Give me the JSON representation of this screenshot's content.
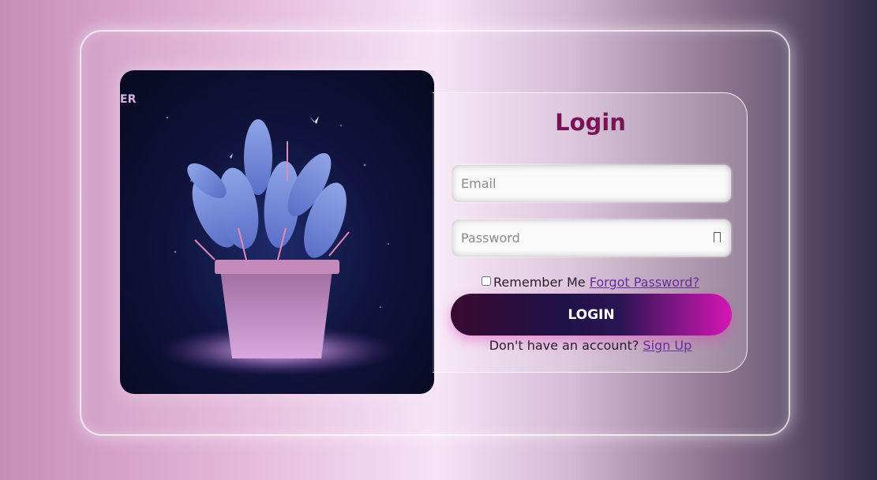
{
  "login_form": {
    "title": "Login",
    "email_placeholder": "Email",
    "password_placeholder": "Password",
    "remember_label": "Remember Me",
    "forgot_password_link": "Forgot Password?",
    "login_button": "LOGIN",
    "signup_prompt": "Don't have an account?",
    "signup_link": "Sign Up"
  },
  "illustration": {
    "corner_text": "ER",
    "subject": "potted-plant-illustration"
  },
  "colors": {
    "title": "#7a1257",
    "link": "#6a2aa0",
    "button_start": "#3a0a30",
    "button_end": "#d616b6"
  }
}
